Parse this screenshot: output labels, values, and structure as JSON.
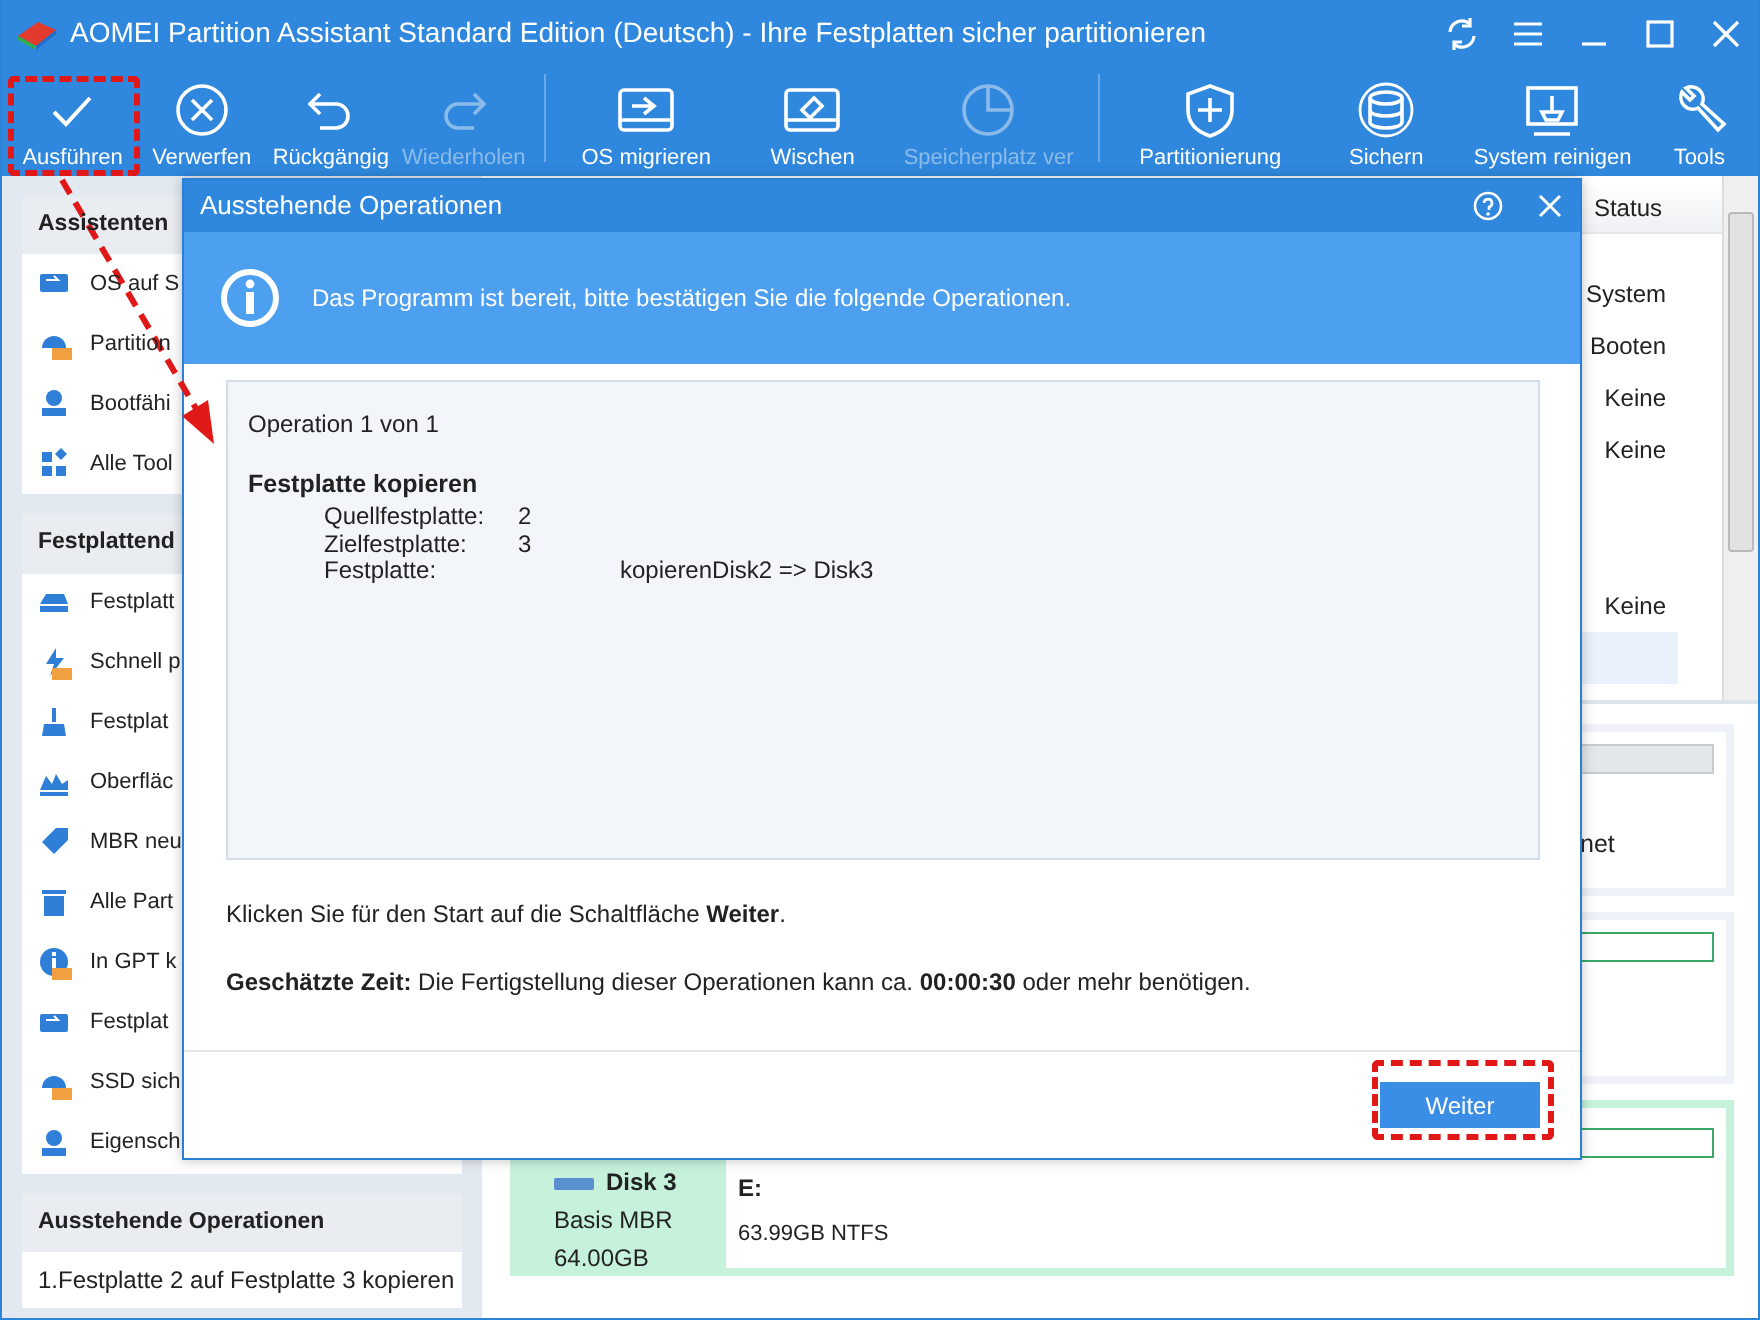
{
  "window": {
    "title": "AOMEI Partition Assistant Standard Edition (Deutsch) - Ihre Festplatten sicher partitionieren"
  },
  "toolbar": [
    {
      "label": "Ausführen",
      "disabled": false
    },
    {
      "label": "Verwerfen",
      "disabled": false
    },
    {
      "label": "Rückgängig",
      "disabled": false
    },
    {
      "label": "Wiederholen",
      "disabled": true
    },
    {
      "label": "OS migrieren",
      "disabled": false
    },
    {
      "label": "Wischen",
      "disabled": false
    },
    {
      "label": "Speicherplatz ver",
      "disabled": true
    },
    {
      "label": "Partitionierung",
      "disabled": false
    },
    {
      "label": "Sichern",
      "disabled": false
    },
    {
      "label": "System reinigen",
      "disabled": false
    },
    {
      "label": "Tools",
      "disabled": false
    }
  ],
  "sidebar": {
    "sections": [
      {
        "title": "Assistenten",
        "items": [
          {
            "kind": "tool",
            "label": "OS auf S",
            "pro": false
          },
          {
            "kind": "tool",
            "label": "Partition",
            "pro": true
          },
          {
            "kind": "tool",
            "label": "Bootfähi",
            "pro": false
          },
          {
            "kind": "tool",
            "label": "Alle Tool",
            "pro": false
          }
        ]
      },
      {
        "title": "Festplattend",
        "items": [
          {
            "kind": "tool",
            "label": "Festplatt",
            "pro": false
          },
          {
            "kind": "tool",
            "label": "Schnell p",
            "pro": true
          },
          {
            "kind": "tool",
            "label": "Festplat",
            "pro": false
          },
          {
            "kind": "tool",
            "label": "Oberfläc",
            "pro": false
          },
          {
            "kind": "tool",
            "label": "MBR neu",
            "pro": false
          },
          {
            "kind": "tool",
            "label": "Alle Part",
            "pro": false
          },
          {
            "kind": "tool",
            "label": "In GPT k",
            "pro": true
          },
          {
            "kind": "tool",
            "label": "Festplat",
            "pro": false
          },
          {
            "kind": "tool",
            "label": "SSD sich",
            "pro": true
          },
          {
            "kind": "tool",
            "label": "Eigensch",
            "pro": false
          }
        ]
      },
      {
        "title": "Ausstehende Operationen",
        "items": [
          {
            "kind": "operation",
            "label": "1.Festplatte 2 auf Festplatte 3 kopieren"
          }
        ]
      }
    ]
  },
  "table": {
    "columns": [
      {
        "label": "Status"
      }
    ],
    "rows": [
      {
        "status": "System",
        "selected": false
      },
      {
        "status": "Booten",
        "selected": false
      },
      {
        "status": "Keine",
        "selected": false
      },
      {
        "status": "Keine",
        "selected": false
      },
      {
        "selected": false
      },
      {
        "selected": false
      },
      {
        "status": "Keine",
        "selected": false
      },
      {
        "selected": true
      }
    ]
  },
  "disk_cards": [
    {
      "selected": false,
      "note": "net"
    },
    {
      "selected": false
    },
    {
      "selected": true,
      "name": "Disk 3",
      "type": "Basis MBR",
      "size": "64.00GB",
      "partition": {
        "letter": "E:",
        "info": "63.99GB NTFS"
      }
    }
  ],
  "dialog": {
    "title": "Ausstehende Operationen",
    "banner": "Das Programm ist bereit, bitte bestätigen Sie die folgende Operationen.",
    "operation_count": "Operation 1 von 1",
    "operation_title": "Festplatte kopieren",
    "details": [
      {
        "label": "Quellfestplatte:",
        "value": "2",
        "wide": false
      },
      {
        "label": "Zielfestplatte:",
        "value": "3",
        "wide": false
      },
      {
        "label": "Festplatte:",
        "value": "kopierenDisk2 => Disk3",
        "wide": true
      }
    ],
    "hint": "Klicken Sie für den Start auf die Schaltfläche **Weiter**.",
    "estimate": "**Geschätzte Zeit:** Die Fertigstellung dieser Operationen kann ca. **00:00:30** oder mehr benötigen.",
    "button": "Weiter"
  },
  "annotations": [
    {
      "kind": "frame"
    },
    {
      "kind": "frame"
    },
    {
      "kind": "arrow"
    }
  ]
}
